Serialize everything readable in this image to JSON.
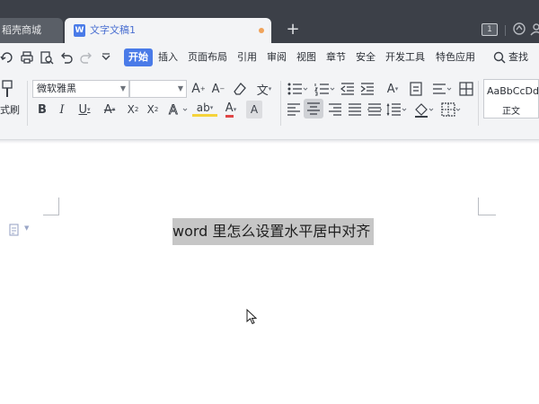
{
  "window": {
    "title": "",
    "tabs": [
      {
        "label": "稻壳商城"
      },
      {
        "label": "文字文稿1"
      }
    ],
    "new_tab": "+",
    "page_badge": "1"
  },
  "menu": {
    "items": [
      "开始",
      "插入",
      "页面布局",
      "引用",
      "审阅",
      "视图",
      "章节",
      "安全",
      "开发工具",
      "特色应用"
    ],
    "search": "查找"
  },
  "ribbon": {
    "format_brush": "式刷",
    "font_name": "微软雅黑",
    "font_size": "",
    "style_sample": "AaBbCcDd",
    "style_name": "正文"
  },
  "document": {
    "selected_text": "word 里怎么设置水平居中对齐"
  },
  "colors": {
    "accent": "#4a7be8",
    "titlebar": "#3c4048",
    "selection": "#c6c6c6",
    "font_color_red": "#e04646",
    "highlight_yellow": "#f5d33b"
  }
}
